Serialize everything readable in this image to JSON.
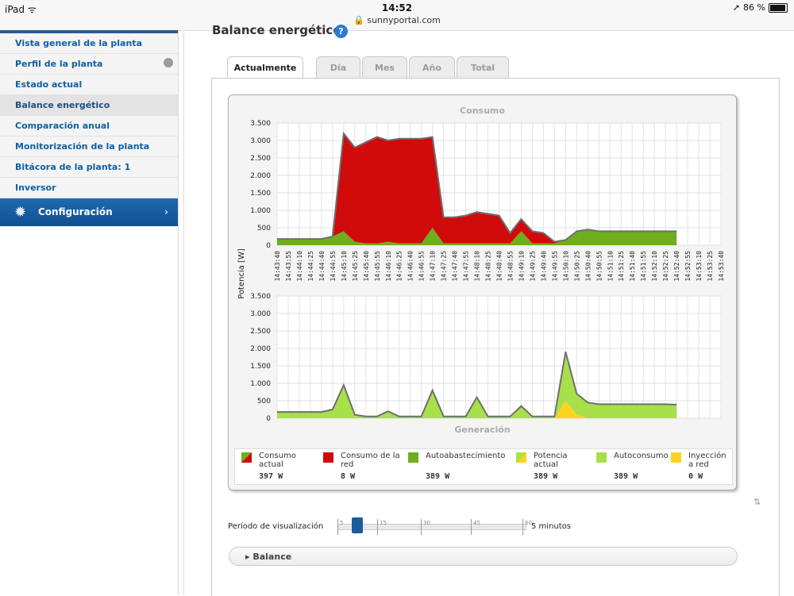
{
  "status_bar": {
    "device": "iPad ᯤ",
    "time": "14:52",
    "url": "🔒 sunnyportal.com",
    "battery": "86 %"
  },
  "sidebar": {
    "items": [
      {
        "label": "Vista general de la planta"
      },
      {
        "label": "Perfil de la planta"
      },
      {
        "label": "Estado actual"
      },
      {
        "label": "Balance energético"
      },
      {
        "label": "Comparación anual"
      },
      {
        "label": "Monitorización de la planta"
      },
      {
        "label": "Bitácora de la planta: 1"
      },
      {
        "label": "Inversor"
      }
    ],
    "config_label": "Configuración",
    "config_chevron": "›"
  },
  "page": {
    "title": "Balance energético",
    "help": "?"
  },
  "tabs": [
    {
      "label": "Actualmente"
    },
    {
      "label": "Día"
    },
    {
      "label": "Mes"
    },
    {
      "label": "Año"
    },
    {
      "label": "Total"
    }
  ],
  "colors": {
    "red": "#d10b0b",
    "green": "#6fae1e",
    "lightgreen": "#a8e04a",
    "yellow": "#ffd21f",
    "grayline": "#6f6f6f",
    "nav_blue": "#0f5fa3"
  },
  "chart_data": [
    {
      "type": "area",
      "title": "Consumo",
      "ylabel": "Potencia [W]",
      "ylim": [
        0,
        3500
      ],
      "y_ticks": [
        "3.500",
        "3.000",
        "2.500",
        "2.000",
        "1.500",
        "1.000",
        "500",
        "0"
      ],
      "x": [
        "14:43:40",
        "14:43:55",
        "14:44:10",
        "14:44:25",
        "14:44:40",
        "14:44:55",
        "14:45:10",
        "14:45:25",
        "14:45:40",
        "14:45:55",
        "14:46:10",
        "14:46:25",
        "14:46:40",
        "14:46:55",
        "14:47:10",
        "14:47:25",
        "14:47:40",
        "14:47:55",
        "14:48:10",
        "14:48:25",
        "14:48:40",
        "14:48:55",
        "14:49:10",
        "14:49:25",
        "14:49:40",
        "14:49:55",
        "14:50:10",
        "14:50:25",
        "14:50:40",
        "14:50:55",
        "14:51:10",
        "14:51:25",
        "14:51:40",
        "14:51:55",
        "14:52:10",
        "14:52:25",
        "14:52:40",
        "14:52:55",
        "14:53:10",
        "14:53:25",
        "14:53:40"
      ],
      "series": [
        {
          "name": "Consumo de la red",
          "values": [
            0,
            0,
            0,
            0,
            0,
            0,
            2800,
            2700,
            2900,
            3050,
            2900,
            3000,
            3000,
            3000,
            2600,
            750,
            750,
            800,
            900,
            850,
            800,
            300,
            350,
            350,
            300,
            50,
            0,
            0,
            0,
            0,
            0,
            0,
            0,
            0,
            0,
            0,
            0
          ]
        },
        {
          "name": "Autoabastecimiento",
          "values": [
            180,
            180,
            180,
            180,
            180,
            250,
            400,
            100,
            50,
            50,
            100,
            50,
            50,
            50,
            500,
            50,
            50,
            50,
            50,
            50,
            50,
            50,
            400,
            50,
            50,
            50,
            150,
            400,
            450,
            400,
            400,
            400,
            400,
            400,
            400,
            400,
            397
          ]
        }
      ]
    },
    {
      "type": "area",
      "title": "Generación",
      "ylim": [
        0,
        3500
      ],
      "y_ticks": [
        "3.500",
        "3.000",
        "2.500",
        "2.000",
        "1.500",
        "1.000",
        "500",
        "0"
      ],
      "series": [
        {
          "name": "Autoconsumo",
          "values": [
            180,
            180,
            180,
            180,
            180,
            250,
            950,
            100,
            50,
            50,
            200,
            50,
            50,
            50,
            800,
            50,
            50,
            50,
            600,
            50,
            50,
            50,
            350,
            50,
            50,
            50,
            1400,
            600,
            450,
            400,
            400,
            400,
            400,
            400,
            400,
            400,
            389
          ]
        },
        {
          "name": "Inyección a red",
          "values": [
            0,
            0,
            0,
            0,
            0,
            0,
            0,
            0,
            0,
            0,
            0,
            0,
            0,
            0,
            0,
            0,
            0,
            0,
            0,
            0,
            0,
            0,
            0,
            0,
            0,
            0,
            500,
            100,
            0,
            0,
            0,
            0,
            0,
            0,
            0,
            0,
            0
          ]
        }
      ]
    }
  ],
  "legend": [
    {
      "label": "Consumo actual",
      "value": "397 W",
      "swatch": "split-red-green"
    },
    {
      "label": "Consumo de la red",
      "value": "8 W",
      "swatch": "red"
    },
    {
      "label": "Autoabastecimiento",
      "value": "389 W",
      "swatch": "green"
    },
    {
      "label": "Potencia actual",
      "value": "389 W",
      "swatch": "split-green-yellow"
    },
    {
      "label": "Autoconsumo",
      "value": "389 W",
      "swatch": "lightgreen"
    },
    {
      "label": "Inyección a red",
      "value": "0 W",
      "swatch": "yellow"
    }
  ],
  "period": {
    "label": "Período de visualización",
    "ticks": [
      "5",
      "15",
      "30",
      "45",
      "60"
    ],
    "selected": 5,
    "value": "5 minutos"
  },
  "balance_label": "Balance"
}
